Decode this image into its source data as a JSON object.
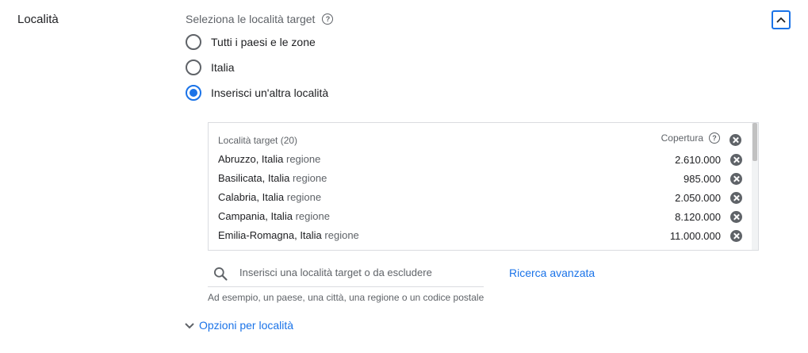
{
  "section": {
    "title": "Località"
  },
  "target": {
    "label": "Seleziona le località target",
    "help_icon": "?",
    "options": [
      {
        "label": "Tutti i paesi e le zone",
        "checked": false
      },
      {
        "label": "Italia",
        "checked": false
      },
      {
        "label": "Inserisci un'altra località",
        "checked": true
      }
    ]
  },
  "locations": {
    "header": "Località target (20)",
    "coverage_label": "Copertura",
    "rows": [
      {
        "name": "Abruzzo, Italia",
        "type": "regione",
        "reach": "2.610.000"
      },
      {
        "name": "Basilicata, Italia",
        "type": "regione",
        "reach": "985.000"
      },
      {
        "name": "Calabria, Italia",
        "type": "regione",
        "reach": "2.050.000"
      },
      {
        "name": "Campania, Italia",
        "type": "regione",
        "reach": "8.120.000"
      },
      {
        "name": "Emilia-Romagna, Italia",
        "type": "regione",
        "reach": "11.000.000"
      }
    ]
  },
  "search": {
    "placeholder": "Inserisci una località target o da escludere",
    "advanced_link": "Ricerca avanzata",
    "hint": "Ad esempio, un paese, una città, una regione o un codice postale"
  },
  "options_toggle": {
    "label": "Opzioni per località"
  },
  "colors": {
    "accent": "#1a73e8",
    "text": "#202124",
    "secondary": "#5f6368",
    "border": "#dadce0"
  }
}
